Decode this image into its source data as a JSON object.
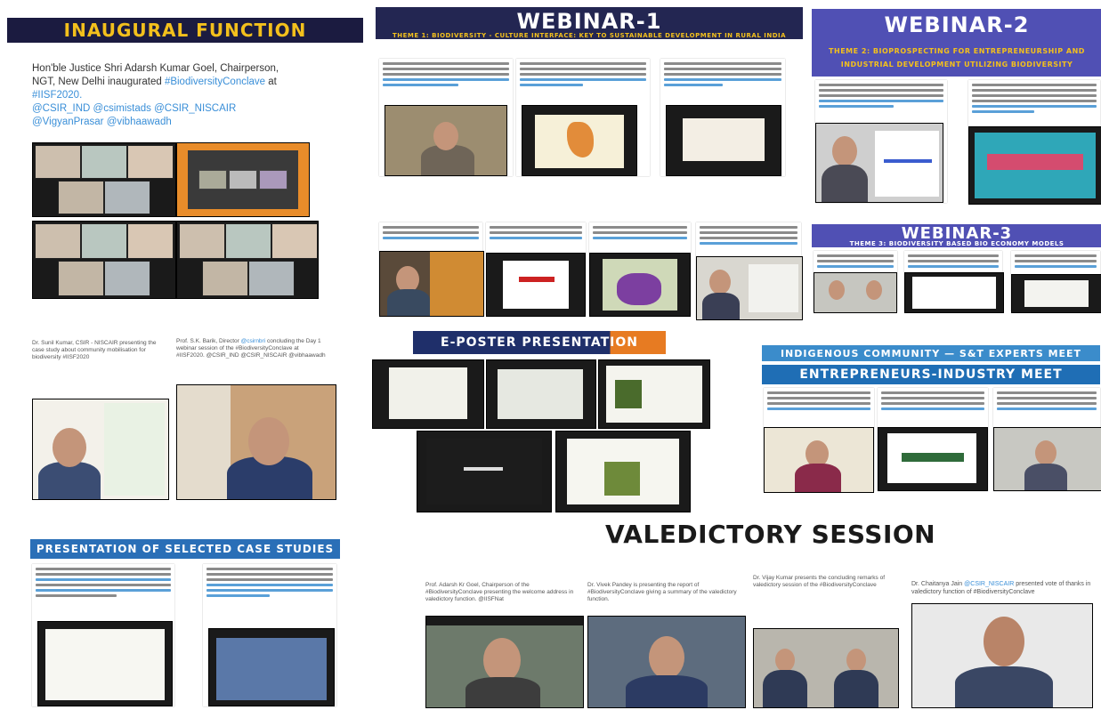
{
  "banners": {
    "inaugural": "Inaugural Function",
    "webinar1": "WEBINAR-1",
    "webinar1_theme": "Theme 1: Biodiversity - Culture Interface: Key to Sustainable Development in Rural India",
    "webinar2": "WEBINAR-2",
    "webinar2_theme_1": "Theme 2: Bioprospecting for Entrepreneurship and",
    "webinar2_theme_2": "Industrial Development Utilizing Biodiversity",
    "webinar3": "WEBINAR-3",
    "webinar3_theme": "Theme 3: Biodiversity Based Bio Economy Models",
    "eposter": "E-POSTER PRESENTATION",
    "indigenous": "INDIGENOUS COMMUNITY — S&T EXPERTS MEET",
    "entrepreneurs": "ENTREPRENEURS-INDUSTRY MEET",
    "case_studies": "Presentation of Selected Case Studies",
    "valedictory": "VALEDICTORY SESSION"
  },
  "inaugural_tweet": {
    "line1": "Hon'ble Justice Shri Adarsh Kumar Goel, Chairperson,",
    "line2_prefix": "NGT, New Delhi inaugurated ",
    "line2_hash": "#BiodiversityConclave",
    "line2_suffix": " at",
    "line3": "#IISF2020.",
    "line4": "@CSIR_IND @csimistads @CSIR_NISCAIR",
    "line5": "@VigyanPrasar @vibhaawadh"
  },
  "valedictory_tweets": {
    "t1": "Prof. Adarsh Kr Goel, Chairperson of the #BiodiversityConclave presenting the welcome address in valedictory function. @IISFNat",
    "t2": "Dr. Vivek Pandey is presenting the report of #BiodiversityConclave giving a summary of the valedictory function.",
    "t3": "Dr. Vijay Kumar presents the concluding remarks of valedictory session of the #BiodiversityConclave",
    "t4_prefix": "Dr. Chaitanya Jain ",
    "t4_hash": "@CSIR_NISCAIR",
    "t4_suffix": " presented vote of thanks in valedictory function of #BiodiversityConclave"
  },
  "mid_left_tweets": {
    "t1": "Dr. Sunil Kumar, CSIR - NISCAIR presenting the case study about community mobilisation for biodiversity #IISF2020",
    "t2_prefix": "Prof. S.K. Barik, Director ",
    "t2_hash": "@csirnbri",
    "t2_suffix": " concluding the Day 1 webinar session of the #BiodiversityConclave at #IISF2020. @CSIR_IND @CSIR_NISCAIR @vibhaawadh"
  },
  "colors": {
    "gold": "#f3c01c",
    "dark_banner": "#1b1b40",
    "purple_banner": "#5050b4",
    "blue_banner": "#2a6fb7",
    "hashtag": "#3a8fd8"
  }
}
